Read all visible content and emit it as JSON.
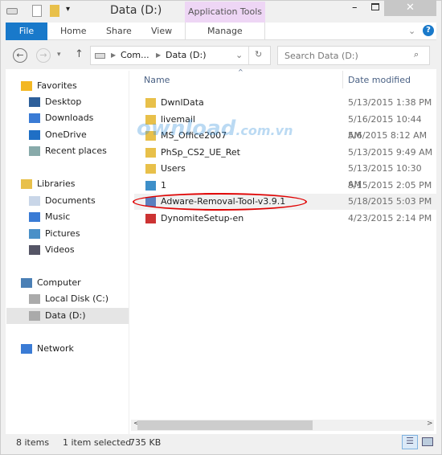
{
  "window": {
    "title": "Data (D:)",
    "context_tab": "Application Tools"
  },
  "ribbon": {
    "tabs": [
      "File",
      "Home",
      "Share",
      "View",
      "Manage"
    ]
  },
  "address": {
    "crumbs": [
      "Com...",
      "Data (D:)"
    ],
    "search_placeholder": "Search Data (D:)"
  },
  "sidebar": {
    "items": [
      {
        "label": "Favorites",
        "head": true,
        "icon": "star-icon"
      },
      {
        "label": "Desktop",
        "icon": "desktop-icon"
      },
      {
        "label": "Downloads",
        "icon": "downloads-icon"
      },
      {
        "label": "OneDrive",
        "icon": "cloud-icon"
      },
      {
        "label": "Recent places",
        "icon": "recent-icon"
      },
      {
        "label": "Libraries",
        "head": true,
        "icon": "library-icon"
      },
      {
        "label": "Documents",
        "icon": "documents-icon"
      },
      {
        "label": "Music",
        "icon": "music-icon"
      },
      {
        "label": "Pictures",
        "icon": "pictures-icon"
      },
      {
        "label": "Videos",
        "icon": "videos-icon"
      },
      {
        "label": "Computer",
        "head": true,
        "icon": "computer-icon"
      },
      {
        "label": "Local Disk (C:)",
        "icon": "drive-icon"
      },
      {
        "label": "Data (D:)",
        "icon": "drive-icon",
        "selected": true
      },
      {
        "label": "Network",
        "head": true,
        "icon": "network-icon"
      }
    ]
  },
  "columns": {
    "name": "Name",
    "date": "Date modified"
  },
  "files": [
    {
      "name": "DwnlData",
      "date": "5/13/2015 1:38 PM",
      "type": "folder"
    },
    {
      "name": "livemail",
      "date": "5/16/2015 10:44 AM",
      "type": "folder"
    },
    {
      "name": "MS_Office2007",
      "date": "5/6/2015 8:12 AM",
      "type": "folder"
    },
    {
      "name": "PhSp_CS2_UE_Ret",
      "date": "5/13/2015 9:49 AM",
      "type": "folder"
    },
    {
      "name": "Users",
      "date": "5/13/2015 10:30 AM",
      "type": "folder"
    },
    {
      "name": "1",
      "date": "5/15/2015 2:05 PM",
      "type": "image"
    },
    {
      "name": "Adware-Removal-Tool-v3.9.1",
      "date": "5/18/2015 5:03 PM",
      "type": "app",
      "selected": true
    },
    {
      "name": "DynomiteSetup-en",
      "date": "4/23/2015 2:14 PM",
      "type": "app"
    }
  ],
  "status": {
    "count": "8 items",
    "selected": "1 item selected",
    "size": "735 KB"
  },
  "watermark": "Download.com.vn",
  "colors": {
    "accent": "#1979ca",
    "highlight": "#e00000",
    "folder": "#e8c04a"
  }
}
